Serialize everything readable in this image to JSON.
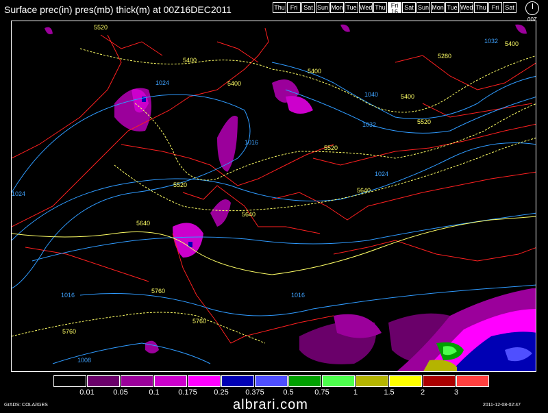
{
  "title": "Surface prec(in) pres(mb) thick(m) at 00Z16DEC2011",
  "days": [
    {
      "label": "Thu",
      "selected": false
    },
    {
      "label": "Fri",
      "selected": false
    },
    {
      "label": "Sat",
      "selected": false
    },
    {
      "label": "Sun",
      "selected": false
    },
    {
      "label": "Mon",
      "selected": false
    },
    {
      "label": "Tue",
      "selected": false
    },
    {
      "label": "Wed",
      "selected": false
    },
    {
      "label": "Thu",
      "selected": false
    },
    {
      "label": "Fri",
      "sub": "16",
      "selected": true
    },
    {
      "label": "Sat",
      "selected": false
    },
    {
      "label": "Sun",
      "selected": false
    },
    {
      "label": "Mon",
      "selected": false
    },
    {
      "label": "Tue",
      "selected": false
    },
    {
      "label": "Wed",
      "selected": false
    },
    {
      "label": "Thu",
      "selected": false
    },
    {
      "label": "Fri",
      "selected": false
    },
    {
      "label": "Sat",
      "selected": false
    }
  ],
  "clock_label": "00Z",
  "colorbar": {
    "colors": [
      "#000000",
      "#6a006a",
      "#9b009b",
      "#cc00cc",
      "#ff00ff",
      "#0000b4",
      "#4f4fff",
      "#00a000",
      "#4dff4d",
      "#b4b400",
      "#ffff00",
      "#aa0000",
      "#ff4040"
    ],
    "ticks": [
      "0.01",
      "0.05",
      "0.1",
      "0.175",
      "0.25",
      "0.375",
      "0.5",
      "0.75",
      "1",
      "1.5",
      "2",
      "3"
    ]
  },
  "isobar_labels": [
    "1024",
    "1040",
    "1032",
    "1016",
    "1024",
    "1024",
    "1016",
    "1016",
    "1008",
    "1032"
  ],
  "thickness_labels": [
    "5520",
    "5400",
    "5400",
    "5400",
    "5280",
    "5400",
    "5400",
    "5520",
    "5520",
    "5520",
    "5640",
    "5640",
    "5640",
    "5760",
    "5760",
    "5760"
  ],
  "footer_left": "GrADS: COLA/IGES",
  "footer_right": "2011-12-08-02:47",
  "brand": "albrari.com"
}
